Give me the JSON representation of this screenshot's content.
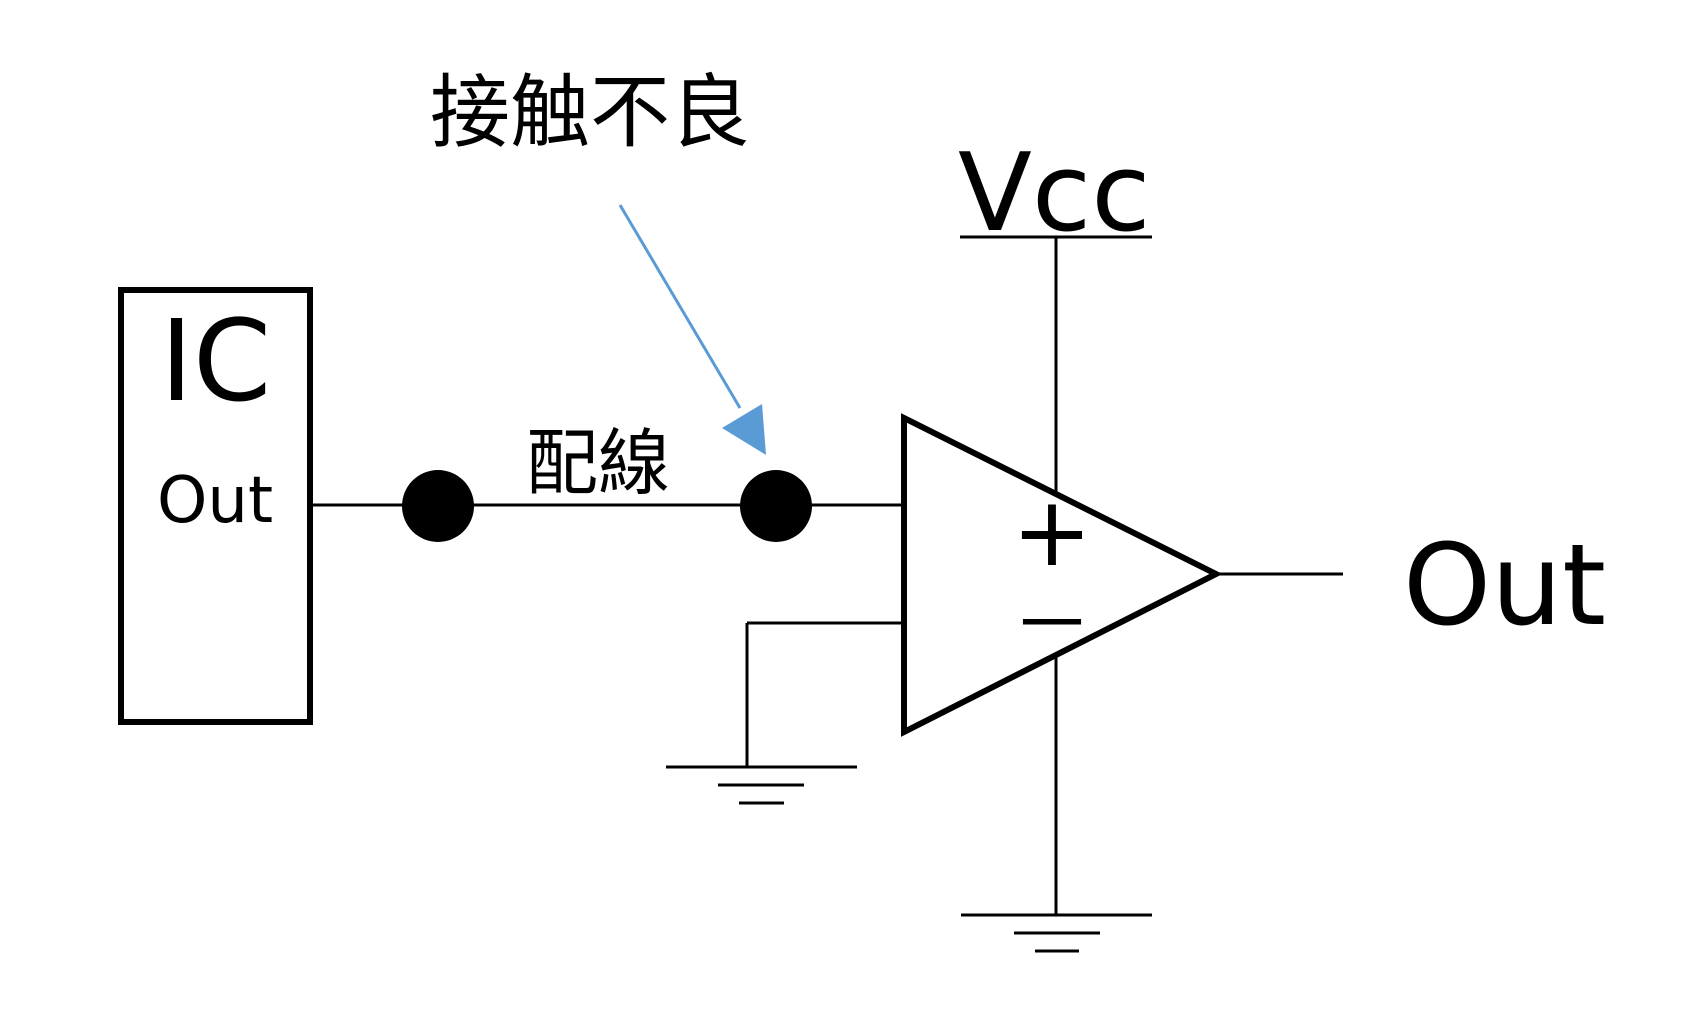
{
  "labels": {
    "contact_fault": "接触不良",
    "wiring": "配線",
    "vcc": "Vcc",
    "ic": "IC",
    "ic_out": "Out",
    "plus": "+",
    "minus": "－",
    "output": "Out"
  },
  "colors": {
    "line": "#000000",
    "arrow": "#5b9bd5",
    "background": "#ffffff"
  }
}
